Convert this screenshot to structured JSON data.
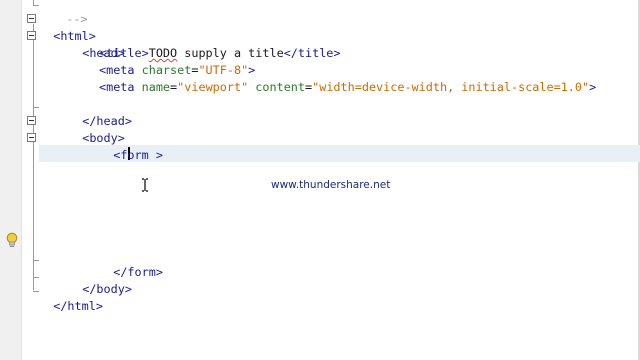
{
  "editor": {
    "lines": {
      "l0": {
        "text": "-->"
      },
      "l1": {
        "open": "<html>"
      },
      "l2": {
        "open": "<head>"
      },
      "l3": {
        "t_open": "<title>",
        "todo": "TODO",
        "rest": " supply a title",
        "t_close": "</title>"
      },
      "l4": {
        "lt": "<meta ",
        "attr": "charset",
        "eq": "=",
        "val": "\"UTF-8\"",
        "gt": ">"
      },
      "l5": {
        "lt": "<meta ",
        "attr1": "name",
        "eq1": "=",
        "val1": "\"viewport\"",
        "sp": " ",
        "attr2": "content",
        "eq2": "=",
        "val2": "\"width=device-width, initial-scale=1.0\"",
        "gt": ">"
      },
      "l6": {
        "close": "</head>"
      },
      "l7": {
        "open": "<body>"
      },
      "l8": {
        "open": "<form >"
      },
      "l10": {
        "close": "</form>"
      },
      "l11": {
        "close": "</body>"
      },
      "l12": {
        "close": "</html>"
      }
    },
    "watermark": "www.thundershare.net"
  }
}
